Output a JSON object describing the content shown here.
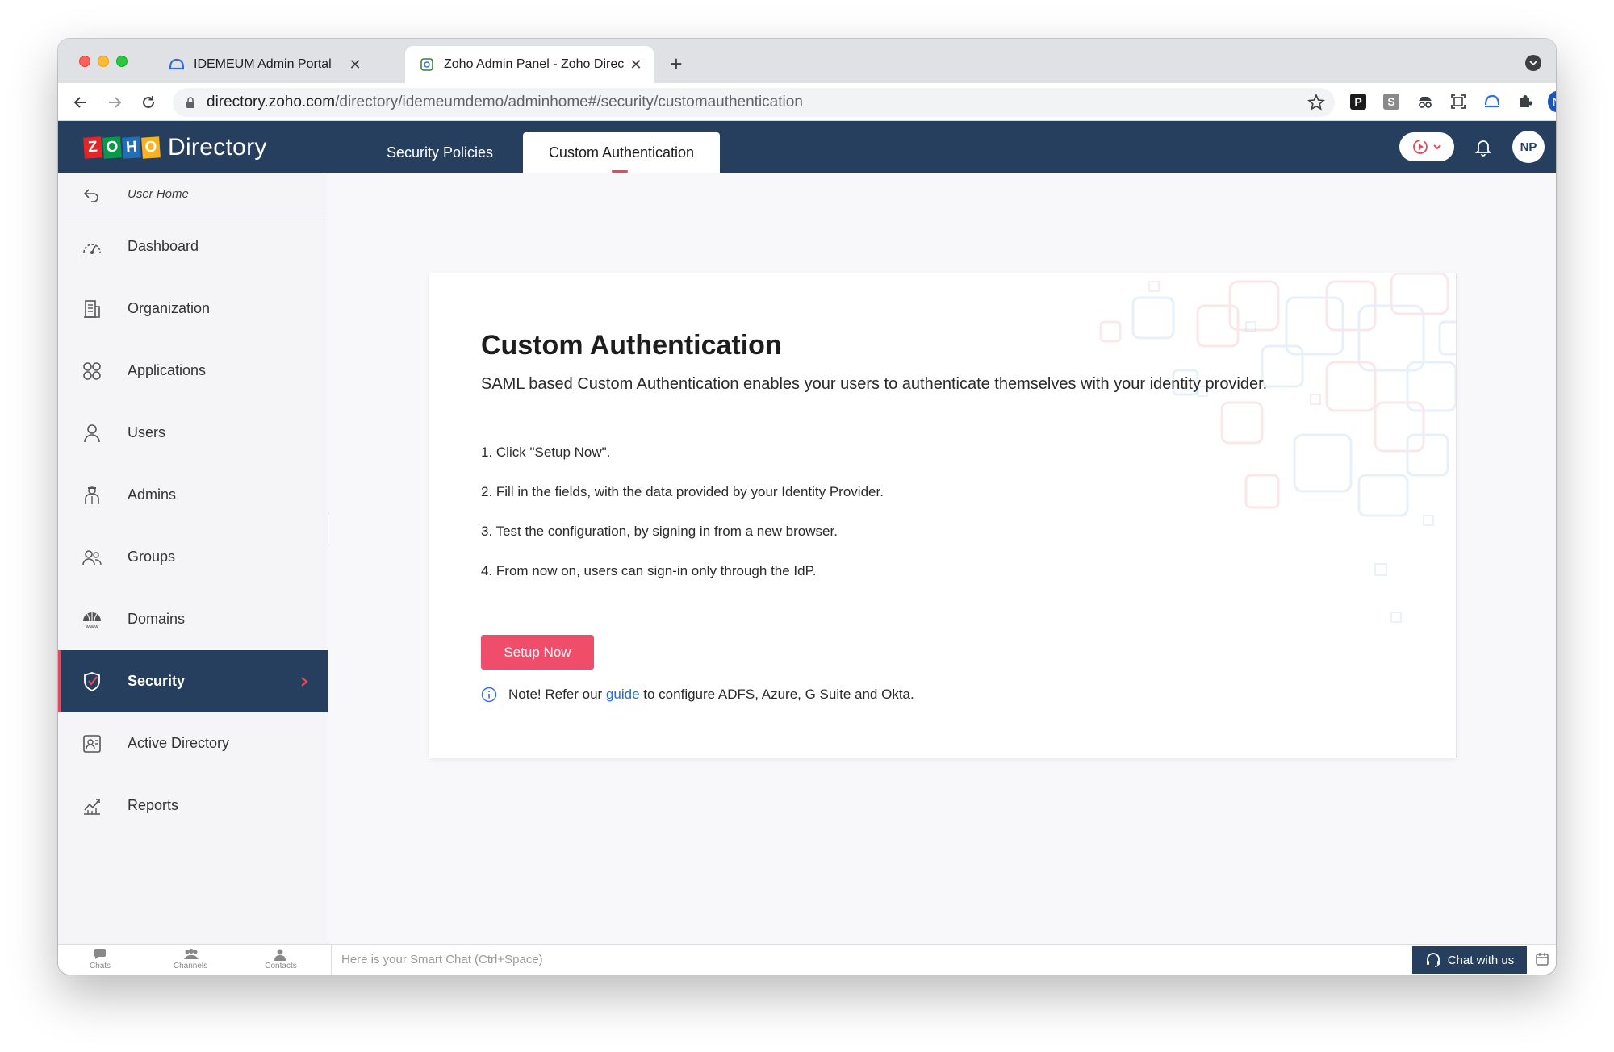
{
  "browser": {
    "tabs": [
      {
        "title": "IDEMEUM Admin Portal",
        "active": false
      },
      {
        "title": "Zoho Admin Panel - Zoho Direc",
        "active": true
      }
    ],
    "new_tab_label": "+",
    "url_domain": "directory.zoho.com",
    "url_path": "/directory/idemeumdemo/adminhome#/security/customauthentication",
    "extensions": [
      "p-icon",
      "s-icon",
      "spy-icon",
      "screenshot-icon",
      "idemeum-icon",
      "puzzle-icon"
    ],
    "profile_initial": "N"
  },
  "header": {
    "logo_letters": [
      "Z",
      "O",
      "H",
      "O"
    ],
    "logo_colors": [
      "#e42527",
      "#089949",
      "#226db4",
      "#f9b21d"
    ],
    "logo_text": "Directory",
    "tabs": [
      {
        "label": "Security Policies",
        "active": false
      },
      {
        "label": "Custom Authentication",
        "active": true
      }
    ],
    "avatar_initials": "NP"
  },
  "sidebar": {
    "user_home": "User Home",
    "items": [
      {
        "label": "Dashboard",
        "icon": "dashboard-icon"
      },
      {
        "label": "Organization",
        "icon": "organization-icon"
      },
      {
        "label": "Applications",
        "icon": "applications-icon"
      },
      {
        "label": "Users",
        "icon": "user-icon"
      },
      {
        "label": "Admins",
        "icon": "admin-icon"
      },
      {
        "label": "Groups",
        "icon": "groups-icon"
      },
      {
        "label": "Domains",
        "icon": "domains-icon"
      },
      {
        "label": "Security",
        "icon": "shield-icon",
        "active": true
      },
      {
        "label": "Active Directory",
        "icon": "active-directory-icon"
      },
      {
        "label": "Reports",
        "icon": "reports-icon"
      }
    ]
  },
  "main": {
    "title": "Custom Authentication",
    "description": "SAML based Custom Authentication enables your users to authenticate themselves with your identity provider.",
    "steps": [
      "1. Click \"Setup Now\".",
      "2. Fill in the fields, with the data provided by your Identity Provider.",
      "3. Test the configuration, by signing in from a new browser.",
      "4. From now on, users can sign-in only through the IdP."
    ],
    "setup_button": "Setup Now",
    "note_prefix": "Note! Refer our ",
    "note_link": "guide",
    "note_suffix": " to configure ADFS, Azure, G Suite and Okta."
  },
  "bottombar": {
    "items": [
      "Chats",
      "Channels",
      "Contacts"
    ],
    "smartchat_placeholder": "Here is your Smart Chat (Ctrl+Space)",
    "chat_button": "Chat with us"
  },
  "colors": {
    "header_bg": "#263f5f",
    "accent": "#e8475d",
    "button": "#ef4d6a",
    "link": "#1f6fd2"
  }
}
